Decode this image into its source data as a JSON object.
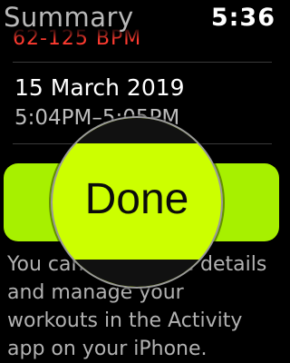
{
  "header": {
    "title": "Summary",
    "time": "5:36"
  },
  "workout": {
    "heart_rate_range": "62-125 BPM",
    "date": "15 March 2019",
    "time_range": "5:04PM–5:05PM"
  },
  "done_label": "Done",
  "info_text": "You can view more details and manage your workouts in the Activity app on your iPhone.",
  "colors": {
    "accent": "#a7f000",
    "heart_rate": "#ff3b30"
  }
}
